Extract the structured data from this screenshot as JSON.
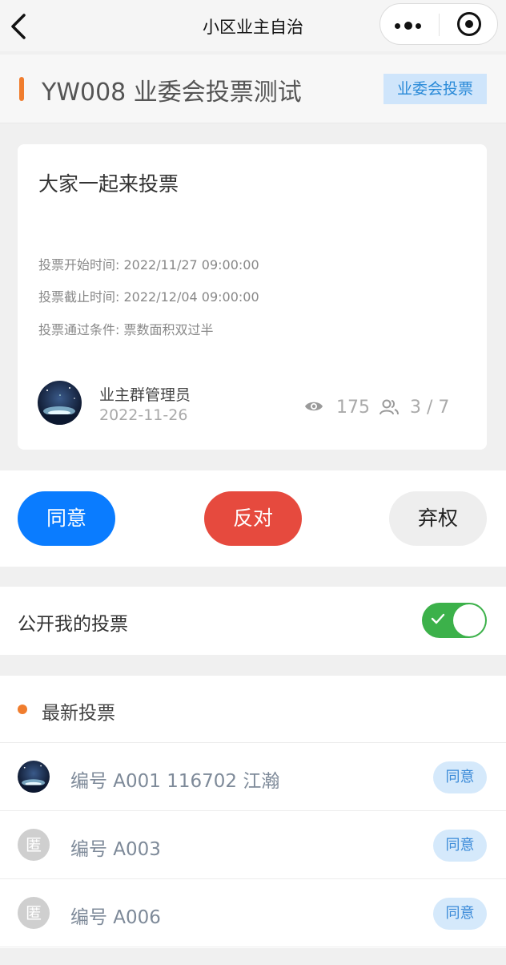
{
  "nav": {
    "title": "小区业主自治"
  },
  "header": {
    "title": "YW008 业委会投票测试",
    "tag": "业委会投票"
  },
  "card": {
    "title": "大家一起来投票",
    "start_time": "投票开始时间: 2022/11/27 09:00:00",
    "end_time": "投票截止时间: 2022/12/04 09:00:00",
    "condition": "投票通过条件: 票数面积双过半",
    "author": "业主群管理员",
    "date": "2022-11-26",
    "views": "175",
    "participants": "3 / 7"
  },
  "vote": {
    "agree": "同意",
    "oppose": "反对",
    "abstain": "弃权"
  },
  "public_vote": {
    "label": "公开我的投票",
    "enabled": true
  },
  "latest": {
    "title": "最新投票",
    "items": [
      {
        "name": "编号 A001 116702 江瀚",
        "status": "同意",
        "avatar": "photo"
      },
      {
        "name": "编号 A003",
        "status": "同意",
        "avatar": "匿"
      },
      {
        "name": "编号 A006",
        "status": "同意",
        "avatar": "匿"
      }
    ]
  },
  "colors": {
    "accent_orange": "#f07d2e",
    "agree_blue": "#0a7cff",
    "oppose_red": "#e64a3e",
    "toggle_green": "#3cb14a"
  }
}
